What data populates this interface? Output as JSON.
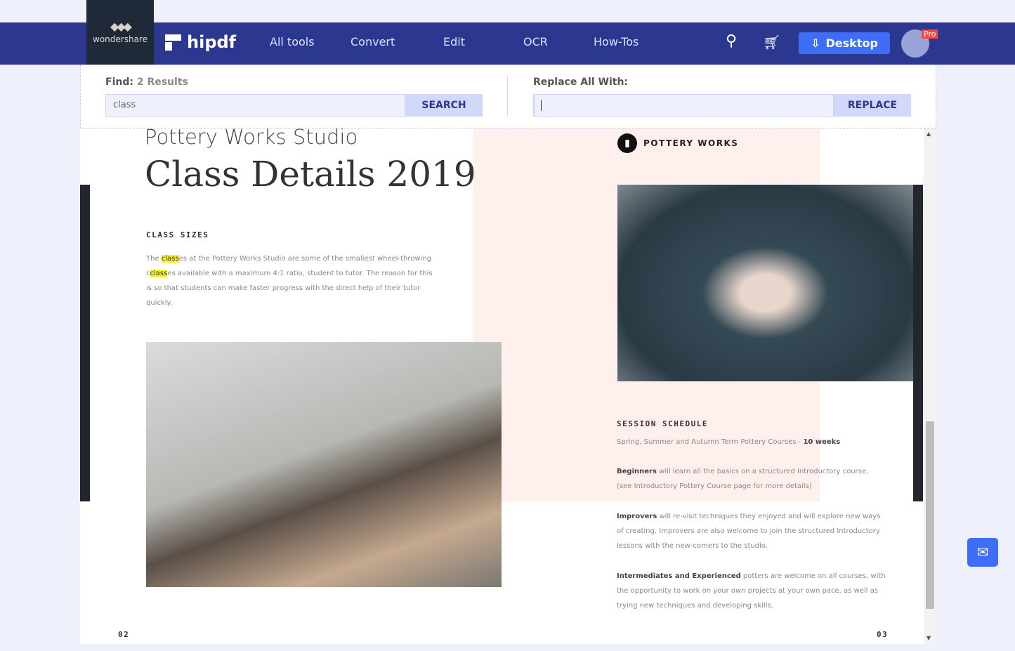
{
  "nav": {
    "brand": "wondershare",
    "product": "hipdf",
    "links": [
      "All tools",
      "Convert",
      "Edit",
      "OCR",
      "How-Tos"
    ],
    "desktop_label": "Desktop",
    "pro_badge": "Pro",
    "accent": "#2c388f",
    "button_color": "#3d6ef5"
  },
  "find": {
    "label": "Find:",
    "results": "2 Results",
    "value": "class",
    "search_label": "SEARCH"
  },
  "replace": {
    "label": "Replace All With:",
    "value": "",
    "replace_label": "REPLACE"
  },
  "doc": {
    "left": {
      "subtitle": "Pottery Works Studio",
      "title": "Class Details 2019",
      "section": "CLASS SIZES",
      "p1a": "The ",
      "hl1": "class",
      "p1b": "es at the Pottery Works Studio are some of the smallest wheel-throwing c",
      "hl2": "class",
      "p1c": "es available with a maximum 4:1 ratio, student to tutor. The reason for this is so that students can make faster progress with the direct help of their tutor quickly.",
      "page": "02"
    },
    "right": {
      "brand": "POTTERY WORKS",
      "section": "SESSION SCHEDULE",
      "s1": "Spring, Summer and Autumn Term Pottery Courses - ",
      "s1b": "10 weeks",
      "b1": "Beginners",
      "t1": " will learn all the basics on a structured Introductory course, (see Introductory Pottery Course page for more details)",
      "b2": "Improvers",
      "t2": " will re-visit techniques they enjoyed and will explore new ways of creating. Improvers are also welcome to join the structured Introductory lessons with the new-comers to the studio.",
      "b3": "Intermediates and Experienced",
      "t3": " potters are welcome on all courses, with the opportunity to work on your own projects at your own pace, as well as trying new techniques and developing skills.",
      "page": "03"
    }
  }
}
